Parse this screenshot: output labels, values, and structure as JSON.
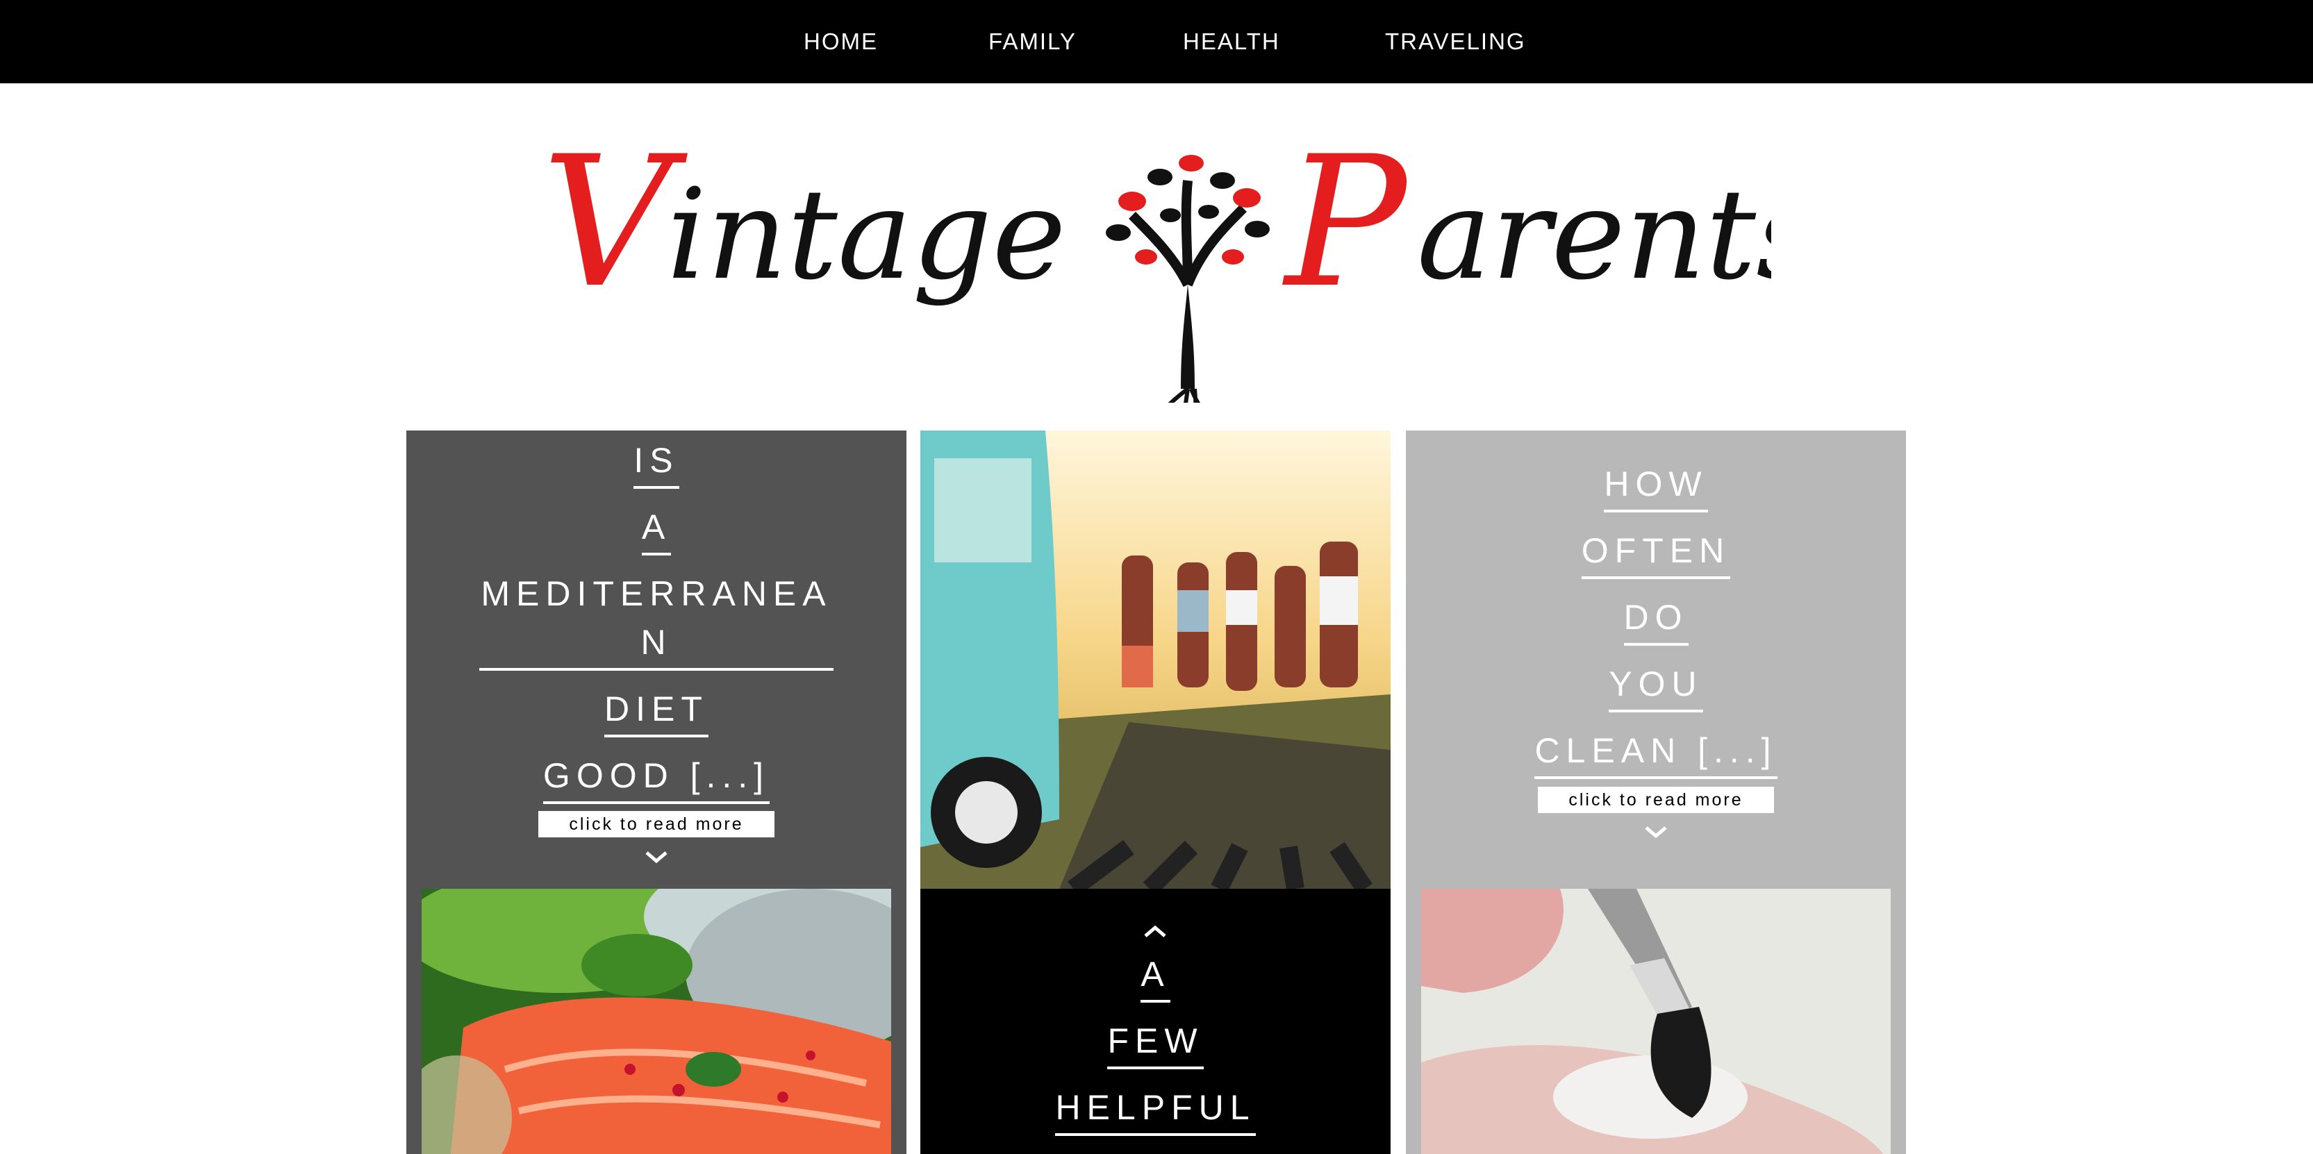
{
  "nav": {
    "items": [
      {
        "label": "HOME"
      },
      {
        "label": "FAMILY"
      },
      {
        "label": "HEALTH"
      },
      {
        "label": "TRAVELING"
      }
    ]
  },
  "logo": {
    "word1": "Vintage",
    "word2": "Parents",
    "colors": {
      "red": "#e41e1e",
      "black": "#111111"
    }
  },
  "posts": {
    "left": {
      "title_words": [
        "IS",
        "A",
        "MEDITERRANEAN",
        "DIET",
        "GOOD [...]"
      ],
      "read_more": "click to read more",
      "image": "salmon-herbs-photo"
    },
    "middle": {
      "title_words": [
        "A",
        "FEW",
        "HELPFUL"
      ],
      "image": "friends-van-road-photo"
    },
    "right": {
      "title_words": [
        "HOW",
        "OFTEN",
        "DO",
        "YOU",
        "CLEAN [...]"
      ],
      "read_more": "click to read more",
      "image": "makeup-brush-photo"
    }
  },
  "colors": {
    "nav_bg": "#000000",
    "left_panel": "#535353",
    "middle_panel": "#000000",
    "right_panel": "#b8b8b8"
  }
}
